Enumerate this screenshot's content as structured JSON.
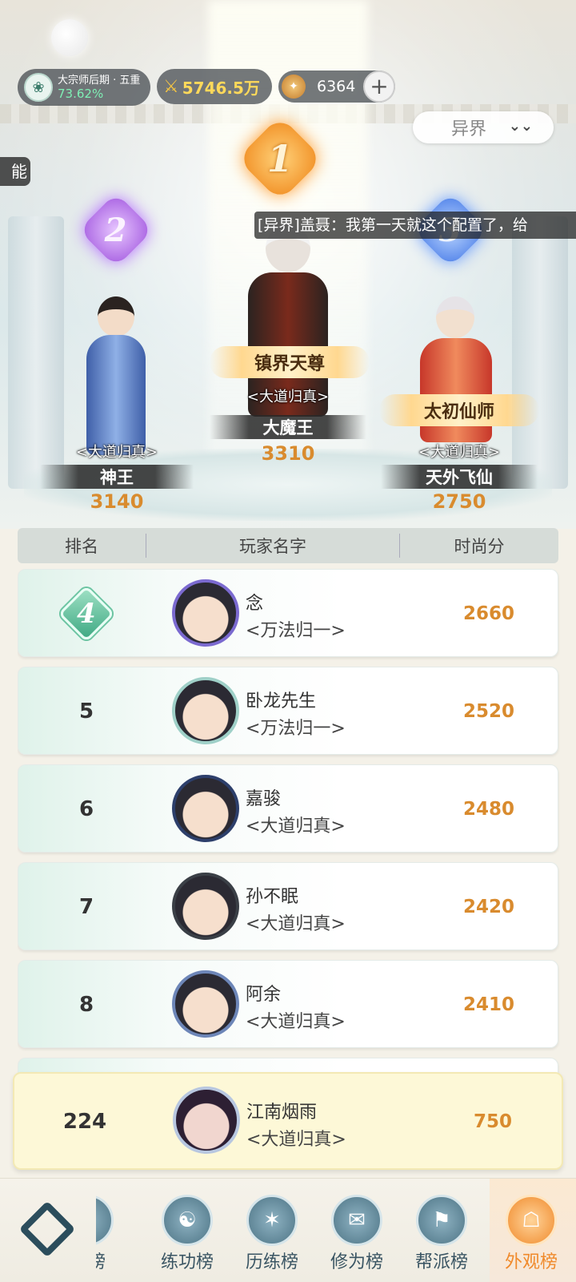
{
  "top_bar": {
    "rank_title": "大宗师后期 · 五重",
    "rank_percent": "73.62%",
    "power_value": "5746.5万",
    "coin_value": "6364",
    "plus_label": "+"
  },
  "realm_select": {
    "value": "异界"
  },
  "side_tag": "能合",
  "chat_message": "[异界]盖聂：我第一天就这个配置了，给",
  "podium": [
    {
      "rank": "1",
      "title": "镇界天尊",
      "guild": "<大道归真>",
      "name": "大魔王",
      "score": "3310"
    },
    {
      "rank": "2",
      "title": "",
      "guild": "<大道归真>",
      "name": "神王",
      "score": "3140"
    },
    {
      "rank": "3",
      "title": "太初仙师",
      "guild": "<大道归真>",
      "name": "天外飞仙",
      "score": "2750"
    }
  ],
  "table_header": {
    "rank": "排名",
    "name": "玩家名字",
    "score": "时尚分"
  },
  "rows": [
    {
      "rank": "4",
      "name": "念",
      "guild": "<万法归一>",
      "score": "2660"
    },
    {
      "rank": "5",
      "name": "卧龙先生",
      "guild": "<万法归一>",
      "score": "2520"
    },
    {
      "rank": "6",
      "name": "嘉骏",
      "guild": "<大道归真>",
      "score": "2480"
    },
    {
      "rank": "7",
      "name": "孙不眠",
      "guild": "<大道归真>",
      "score": "2420"
    },
    {
      "rank": "8",
      "name": "阿余",
      "guild": "<大道归真>",
      "score": "2410"
    }
  ],
  "my_rank": {
    "rank": "224",
    "name": "江南烟雨",
    "guild": "<大道归真>",
    "score": "750"
  },
  "bottom_nav": {
    "items": [
      {
        "label": "功榜",
        "icon": "partial-icon"
      },
      {
        "label": "练功榜",
        "icon": "yin-yang-icon"
      },
      {
        "label": "历练榜",
        "icon": "planet-icon"
      },
      {
        "label": "修为榜",
        "icon": "scroll-icon"
      },
      {
        "label": "帮派榜",
        "icon": "banner-icon"
      },
      {
        "label": "外观榜",
        "icon": "mask-icon"
      }
    ]
  },
  "colors": {
    "score": "#d98b2e",
    "active_nav": "#f08a2c",
    "rank4_badge": "#3fa983",
    "my_row_bg": "#fdf8d7"
  }
}
